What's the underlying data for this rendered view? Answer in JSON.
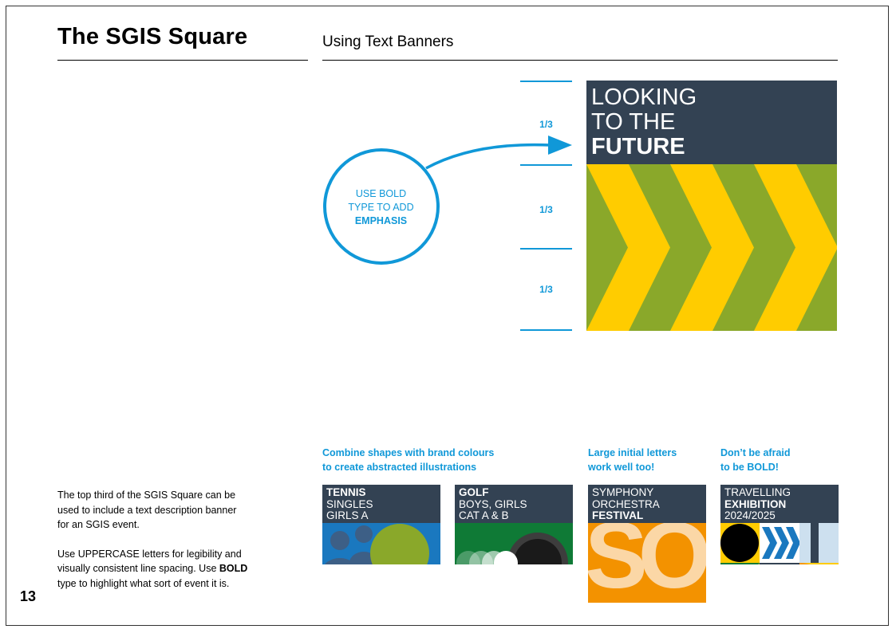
{
  "header": {
    "title": "The SGIS Square",
    "subtitle": "Using Text Banners"
  },
  "diagram": {
    "thirds": [
      "1/3",
      "1/3",
      "1/3"
    ],
    "callout": {
      "line1": "USE BOLD",
      "line2": "TYPE TO ADD",
      "bold": "EMPHASIS"
    },
    "banner": {
      "line1": "LOOKING",
      "line2": "TO THE",
      "bold": "FUTURE"
    },
    "colors": {
      "accent": "#1098d8",
      "navy": "#334253",
      "green": "#8aa82a",
      "yellow": "#ffcc00"
    }
  },
  "captions": {
    "combine": {
      "line1": "Combine shapes with brand colours",
      "line2": "to create abstracted illustrations"
    },
    "large": {
      "line1": "Large initial letters",
      "line2": "work well too!"
    },
    "bold": {
      "line1": "Don’t be afraid",
      "line2": "to be BOLD!"
    }
  },
  "tiles": [
    {
      "bold": "TENNIS",
      "line2": "SINGLES",
      "line3": "GIRLS A"
    },
    {
      "bold": "GOLF",
      "line2": "BOYS, GIRLS",
      "line3": "CAT A & B"
    },
    {
      "line1": "SYMPHONY",
      "line2": "ORCHESTRA",
      "bold": "FESTIVAL",
      "art_letters": "SO"
    },
    {
      "line1": "TRAVELLING",
      "bold": "EXHIBITION",
      "line3": "2024/2025"
    }
  ],
  "body": {
    "para1": "The top third of the SGIS Square can be used to include a text description banner for an SGIS event.",
    "para2_a": "Use UPPERCASE letters for legibility and visually consistent line spacing. Use ",
    "para2_bold": "BOLD",
    "para2_b": " type to highlight what sort of event it is."
  },
  "page_number": "13"
}
